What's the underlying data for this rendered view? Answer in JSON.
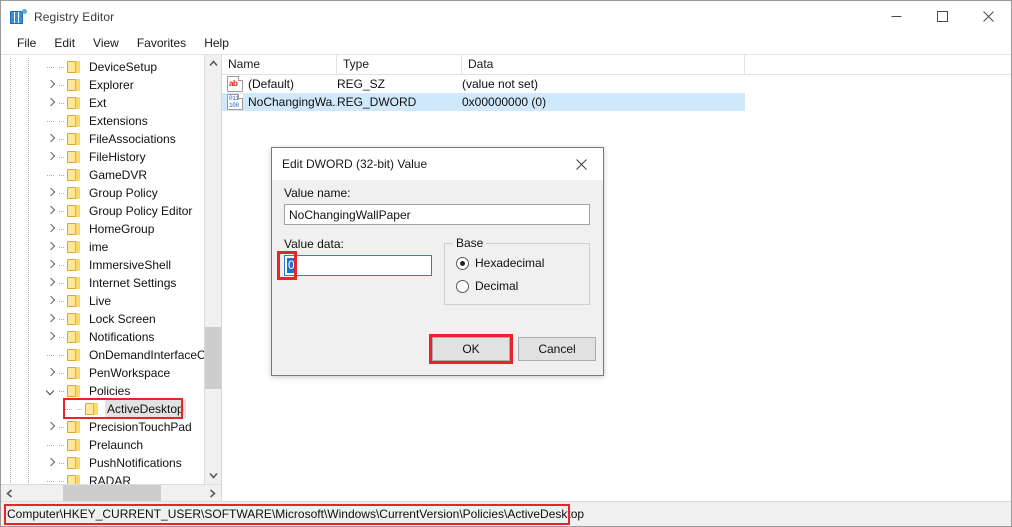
{
  "window": {
    "title": "Registry Editor",
    "icon": "registry-editor-icon",
    "controls": {
      "minimize": "minimize-icon",
      "maximize": "maximize-icon",
      "close": "close-icon"
    }
  },
  "menu": {
    "items": [
      {
        "label": "File"
      },
      {
        "label": "Edit"
      },
      {
        "label": "View"
      },
      {
        "label": "Favorites"
      },
      {
        "label": "Help"
      }
    ]
  },
  "tree": {
    "items": [
      {
        "label": "DeviceSetup",
        "toggle": "none",
        "selected": false
      },
      {
        "label": "Explorer",
        "toggle": "collapsed",
        "selected": false
      },
      {
        "label": "Ext",
        "toggle": "collapsed",
        "selected": false
      },
      {
        "label": "Extensions",
        "toggle": "none",
        "selected": false
      },
      {
        "label": "FileAssociations",
        "toggle": "collapsed",
        "selected": false
      },
      {
        "label": "FileHistory",
        "toggle": "collapsed",
        "selected": false
      },
      {
        "label": "GameDVR",
        "toggle": "none",
        "selected": false
      },
      {
        "label": "Group Policy",
        "toggle": "collapsed",
        "selected": false
      },
      {
        "label": "Group Policy Editor",
        "toggle": "collapsed",
        "selected": false
      },
      {
        "label": "HomeGroup",
        "toggle": "collapsed",
        "selected": false
      },
      {
        "label": "ime",
        "toggle": "collapsed",
        "selected": false
      },
      {
        "label": "ImmersiveShell",
        "toggle": "collapsed",
        "selected": false
      },
      {
        "label": "Internet Settings",
        "toggle": "collapsed",
        "selected": false
      },
      {
        "label": "Live",
        "toggle": "collapsed",
        "selected": false
      },
      {
        "label": "Lock Screen",
        "toggle": "collapsed",
        "selected": false
      },
      {
        "label": "Notifications",
        "toggle": "collapsed",
        "selected": false
      },
      {
        "label": "OnDemandInterfaceCa",
        "toggle": "none",
        "selected": false
      },
      {
        "label": "PenWorkspace",
        "toggle": "collapsed",
        "selected": false
      },
      {
        "label": "Policies",
        "toggle": "expanded",
        "selected": false
      },
      {
        "label": "ActiveDesktop",
        "toggle": "none",
        "selected": true,
        "deep": true,
        "highlight": "red-box"
      },
      {
        "label": "PrecisionTouchPad",
        "toggle": "collapsed",
        "selected": false
      },
      {
        "label": "Prelaunch",
        "toggle": "none",
        "selected": false
      },
      {
        "label": "PushNotifications",
        "toggle": "collapsed",
        "selected": false
      },
      {
        "label": "RADAR",
        "toggle": "none",
        "selected": false
      }
    ],
    "scrollbar": {
      "up_arrow": "chevron-up-icon",
      "down_arrow": "chevron-down-icon",
      "left_arrow": "chevron-left-icon",
      "right_arrow": "chevron-right-icon"
    }
  },
  "list": {
    "columns": [
      "Name",
      "Type",
      "Data"
    ],
    "rows": [
      {
        "icon": "string-value-icon",
        "icon_glyph": "ab",
        "name": "(Default)",
        "type": "REG_SZ",
        "data": "(value not set)",
        "selected": false
      },
      {
        "icon": "dword-value-icon",
        "icon_glyph": "011\n100",
        "name": "NoChangingWa...",
        "type": "REG_DWORD",
        "data": "0x00000000 (0)",
        "selected": true
      }
    ]
  },
  "status": {
    "path": "Computer\\HKEY_CURRENT_USER\\SOFTWARE\\Microsoft\\Windows\\CurrentVersion\\Policies\\ActiveDesktop",
    "highlight": "red-box"
  },
  "dialog": {
    "title": "Edit DWORD (32-bit) Value",
    "close_icon": "close-icon",
    "value_name_label": "Value name:",
    "value_name": "NoChangingWallPaper",
    "value_data_label": "Value data:",
    "value_data": "0",
    "value_data_highlight": "red-box",
    "base": {
      "legend": "Base",
      "options": [
        {
          "label": "Hexadecimal",
          "checked": true
        },
        {
          "label": "Decimal",
          "checked": false
        }
      ]
    },
    "buttons": {
      "ok": "OK",
      "cancel": "Cancel",
      "ok_highlight": "red-box"
    }
  },
  "colors": {
    "annotation_red": "#e8232a",
    "selection_blue": "#cfe8fb",
    "text_select_blue": "#1f6fd0",
    "folder_yellow": "#fde89a"
  }
}
